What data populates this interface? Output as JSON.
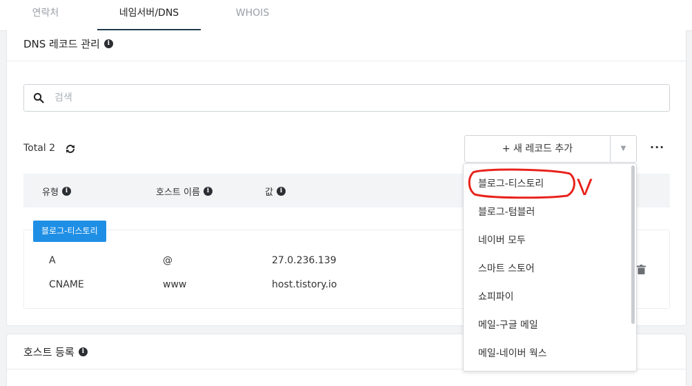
{
  "tabs": [
    {
      "label": "연락처"
    },
    {
      "label": "네임서버/DNS"
    },
    {
      "label": "WHOIS"
    }
  ],
  "dns": {
    "title": "DNS 레코드 관리",
    "search_placeholder": "검색",
    "total_label": "Total 2",
    "add_button": "+ 새 레코드 추가",
    "columns": [
      "유형",
      "호스트 이름",
      "값"
    ],
    "group": {
      "badge": "블로그-티스토리",
      "rows": [
        {
          "type": "A",
          "host": "@",
          "value": "27.0.236.139"
        },
        {
          "type": "CNAME",
          "host": "www",
          "value": "host.tistory.io"
        }
      ]
    }
  },
  "dropdown": {
    "items": [
      "블로그-티스토리",
      "블로그-텀블러",
      "네이버 모두",
      "스마트 스토어",
      "쇼피파이",
      "메일-구글 메일",
      "메일-네이버 웍스"
    ]
  },
  "host_section": {
    "title": "호스트 등록"
  },
  "annotation": {
    "mark": "V",
    "color": "#e8221b"
  },
  "colors": {
    "accent": "#1f8fe5",
    "tab_underline": "#1f3a4d"
  }
}
